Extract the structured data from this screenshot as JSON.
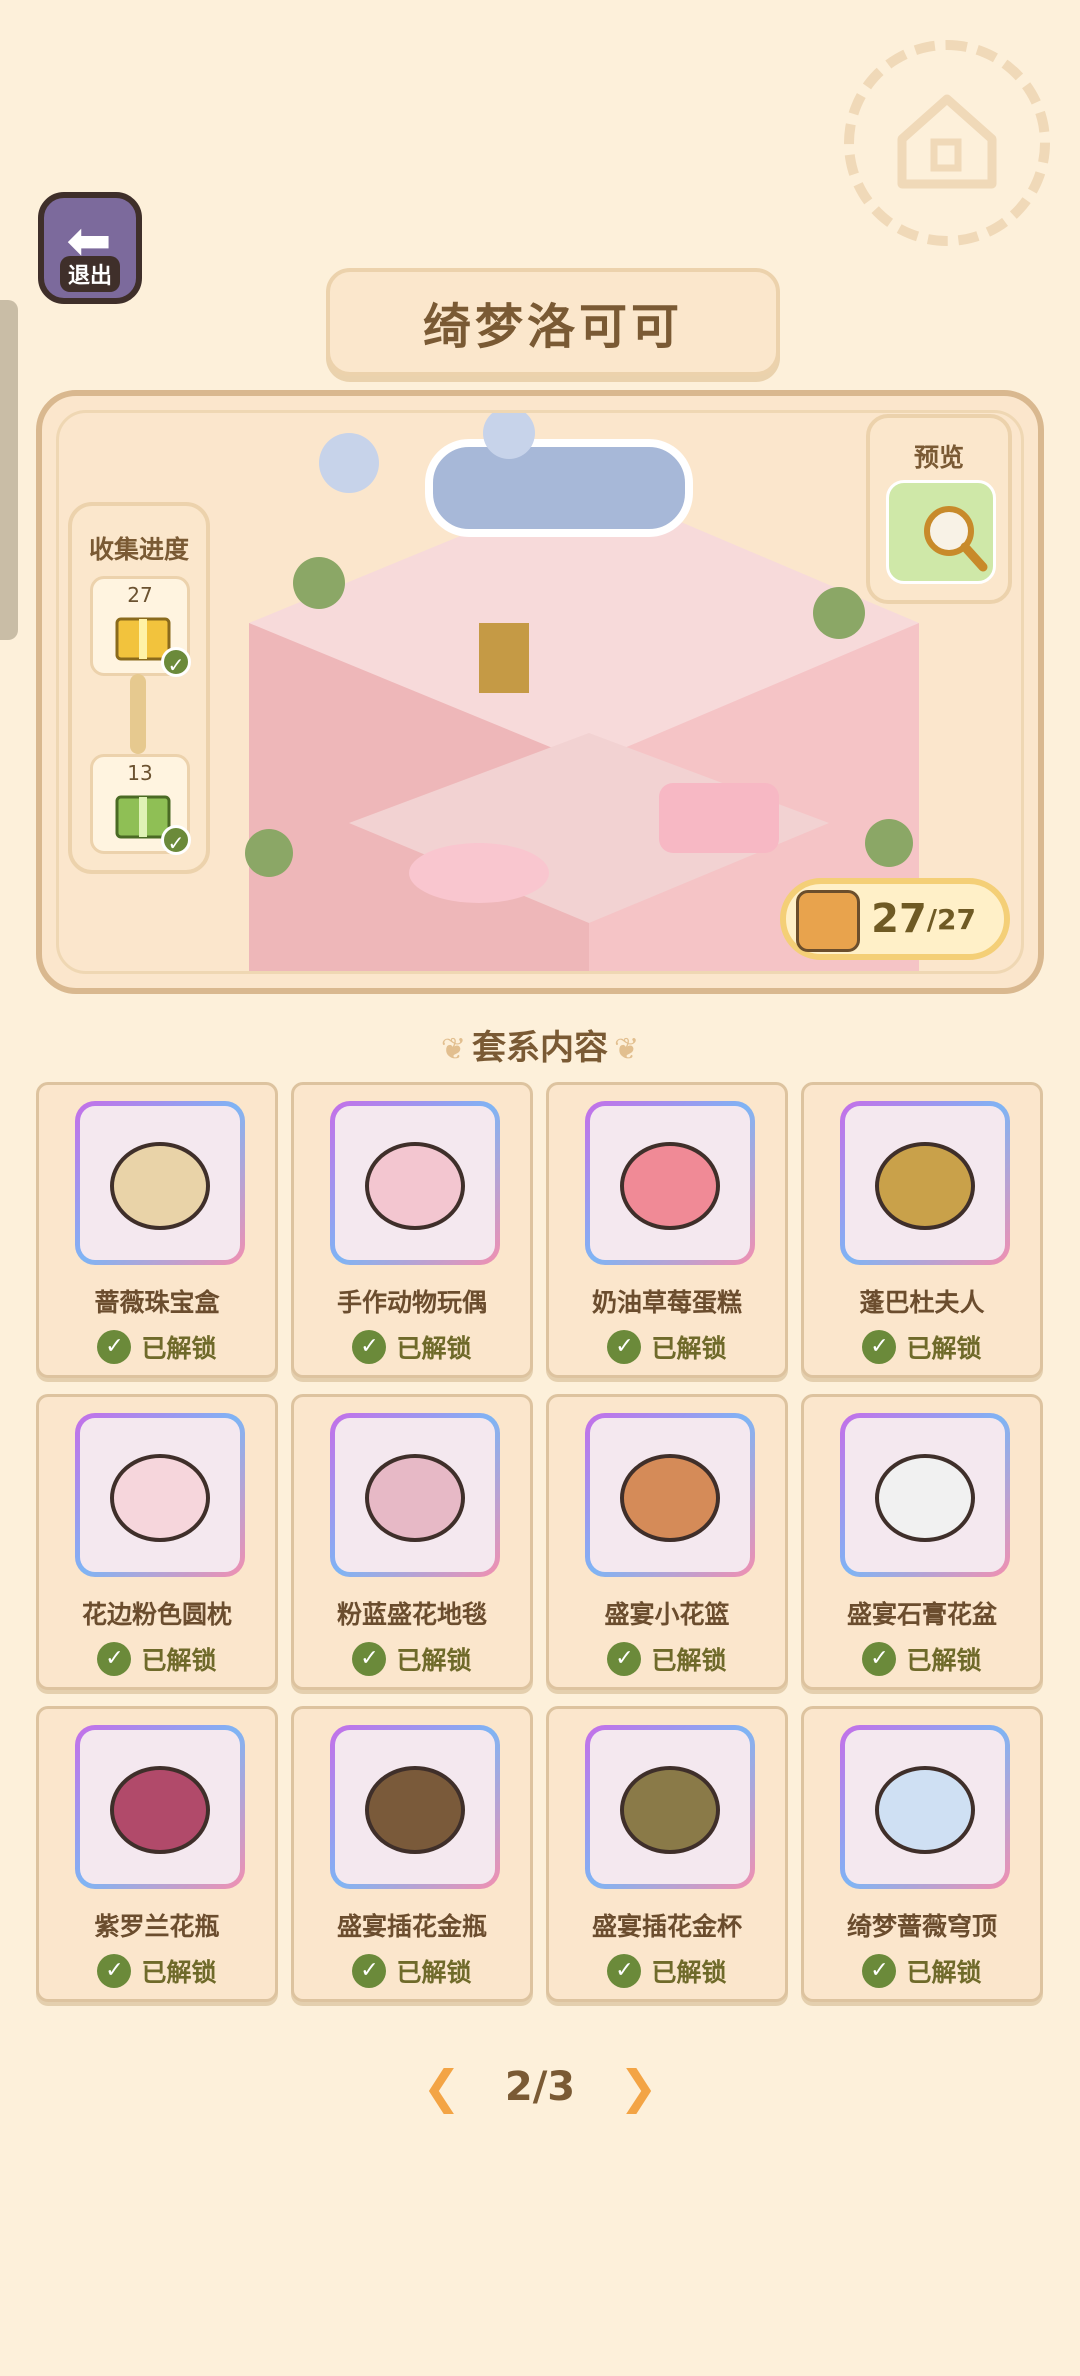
{
  "header": {
    "back_label": "退出",
    "title": "绮梦洛可可"
  },
  "progress": {
    "title": "收集进度",
    "tiers": [
      {
        "count": "27"
      },
      {
        "count": "13"
      }
    ]
  },
  "preview": {
    "label": "预览"
  },
  "collection": {
    "count": "27",
    "total": "/27"
  },
  "section": {
    "title": "套系内容"
  },
  "items": [
    {
      "name": "蔷薇珠宝盒",
      "status": "已解锁"
    },
    {
      "name": "手作动物玩偶",
      "status": "已解锁"
    },
    {
      "name": "奶油草莓蛋糕",
      "status": "已解锁"
    },
    {
      "name": "蓬巴杜夫人",
      "status": "已解锁"
    },
    {
      "name": "花边粉色圆枕",
      "status": "已解锁"
    },
    {
      "name": "粉蓝盛花地毯",
      "status": "已解锁"
    },
    {
      "name": "盛宴小花篮",
      "status": "已解锁"
    },
    {
      "name": "盛宴石膏花盆",
      "status": "已解锁"
    },
    {
      "name": "紫罗兰花瓶",
      "status": "已解锁"
    },
    {
      "name": "盛宴插花金瓶",
      "status": "已解锁"
    },
    {
      "name": "盛宴插花金杯",
      "status": "已解锁"
    },
    {
      "name": "绮梦蔷薇穹顶",
      "status": "已解锁"
    }
  ],
  "pagination": {
    "current": "2/3"
  }
}
